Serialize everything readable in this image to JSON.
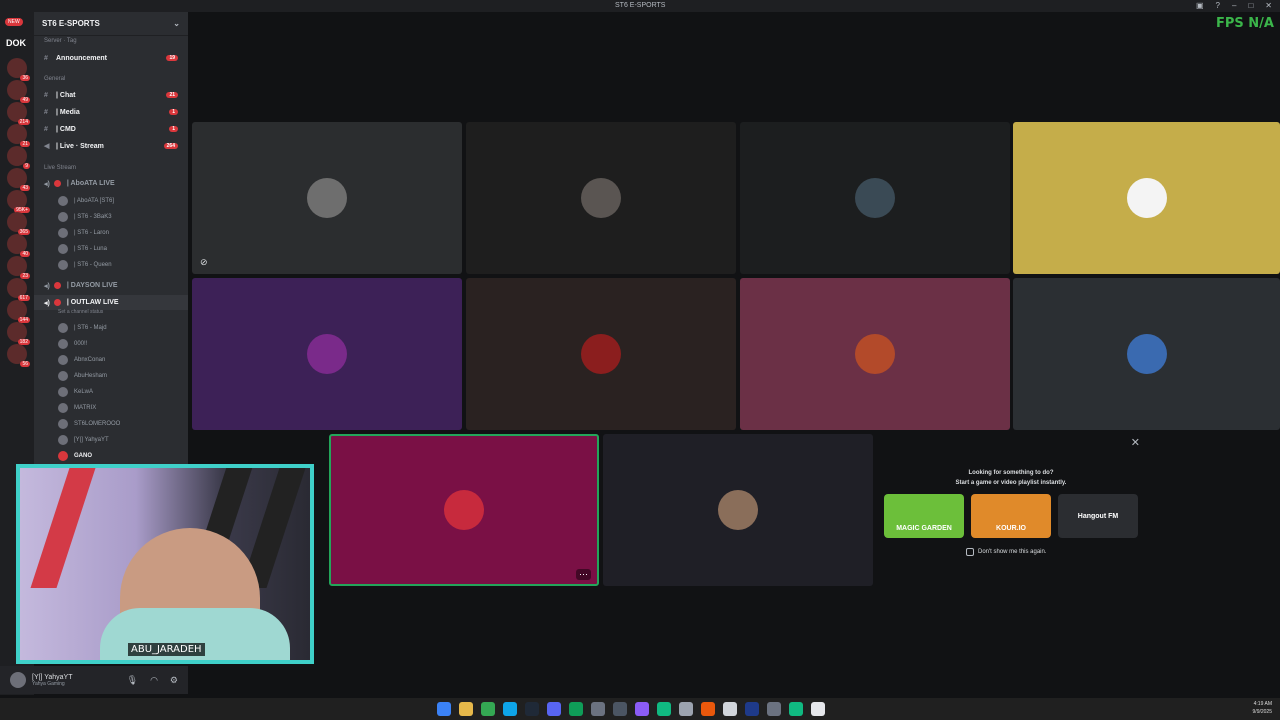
{
  "window": {
    "title": "ST6 E-SPORTS"
  },
  "overlay": {
    "fps_text": "FPS N/A"
  },
  "guild_bar": {
    "new_badge": "NEW",
    "top_label": "DOK",
    "badges": [
      "36",
      "49",
      "214",
      "21",
      "9",
      "43",
      "95K+",
      "365",
      "40",
      "23",
      "617",
      "144",
      "182",
      "56"
    ]
  },
  "server": {
    "name": "ST6 E-SPORTS",
    "server_tag_label": "Server · Tag",
    "text_channels": [
      {
        "name": "Announcement",
        "count": "19"
      },
      {
        "name": "| Chat",
        "count": "21"
      },
      {
        "name": "| Media",
        "count": "1"
      },
      {
        "name": "| CMD",
        "count": "1"
      },
      {
        "name": "| Live · Stream",
        "count": "264"
      }
    ],
    "category_general": "General",
    "category_live": "Live Stream",
    "voice": [
      {
        "name": "| AboATA LIVE",
        "users": [
          "| AboATA [ST6]",
          "| ST6 - 3BaK3",
          "| ST6 - Laron",
          "| ST6 - Luna",
          "| ST6 - Queen"
        ]
      },
      {
        "name": "| DAYSON LIVE",
        "users": []
      },
      {
        "name": "| OUTLAW LIVE",
        "status": "Set a channel status",
        "users": [
          "| ST6 - Majd",
          "000!!",
          "AbnxConan",
          "AbuHesham",
          "KeLwA",
          "MATRIX",
          "ST6LOMEROOO",
          "[Y|] YahyaYT",
          "GANO"
        ]
      }
    ]
  },
  "user_panel": {
    "name": "[Y|] YahyaYT",
    "sub": "Yahya Gaming"
  },
  "webcam": {
    "label": "ABU_JARADEH"
  },
  "tiles": [
    {
      "color": "#2b2d2f",
      "avatar": "#6e6e6e"
    },
    {
      "color": "#1e1e1e",
      "avatar": "#5a5552"
    },
    {
      "color": "#1c1e1f",
      "avatar": "#3a4a55"
    },
    {
      "color": "#c5ad4a",
      "avatar": "#f4f4f4"
    },
    {
      "color": "#3d2157",
      "avatar": "#7a2a8a"
    },
    {
      "color": "#2a2221",
      "avatar": "#8b1e1e"
    },
    {
      "color": "#6b3046",
      "avatar": "#b34a2a"
    },
    {
      "color": "#2b2f33",
      "avatar": "#3a6ab0"
    },
    {
      "color": "#7a1045",
      "avatar": "#c72a3d"
    },
    {
      "color": "#1f1f26",
      "avatar": "#8a6e5a"
    }
  ],
  "activity": {
    "line1": "Looking for something to do?",
    "line2": "Start a game or video playlist instantly.",
    "cards": [
      {
        "label": "MAGIC GARDEN",
        "color": "#6cbf3a"
      },
      {
        "label": "KOUR.IO",
        "color": "#e08a2a"
      },
      {
        "label": "Hangout FM",
        "color": "#2b2d31"
      }
    ],
    "dont_show": "Don't show me this again."
  },
  "tray": {
    "time": "4:19 AM",
    "date": "9/9/2025"
  },
  "taskbar_colors": [
    "#3b82f6",
    "#e6b84a",
    "#34a853",
    "#0ea5e9",
    "#1f2937",
    "#5865f2",
    "#0f9d58",
    "#6b7280",
    "#4b5563",
    "#8b5cf6",
    "#10b981",
    "#9ca3af",
    "#ea580c",
    "#d1d5db",
    "#1e3a8a",
    "#6b7280",
    "#10b981",
    "#e5e7eb"
  ]
}
